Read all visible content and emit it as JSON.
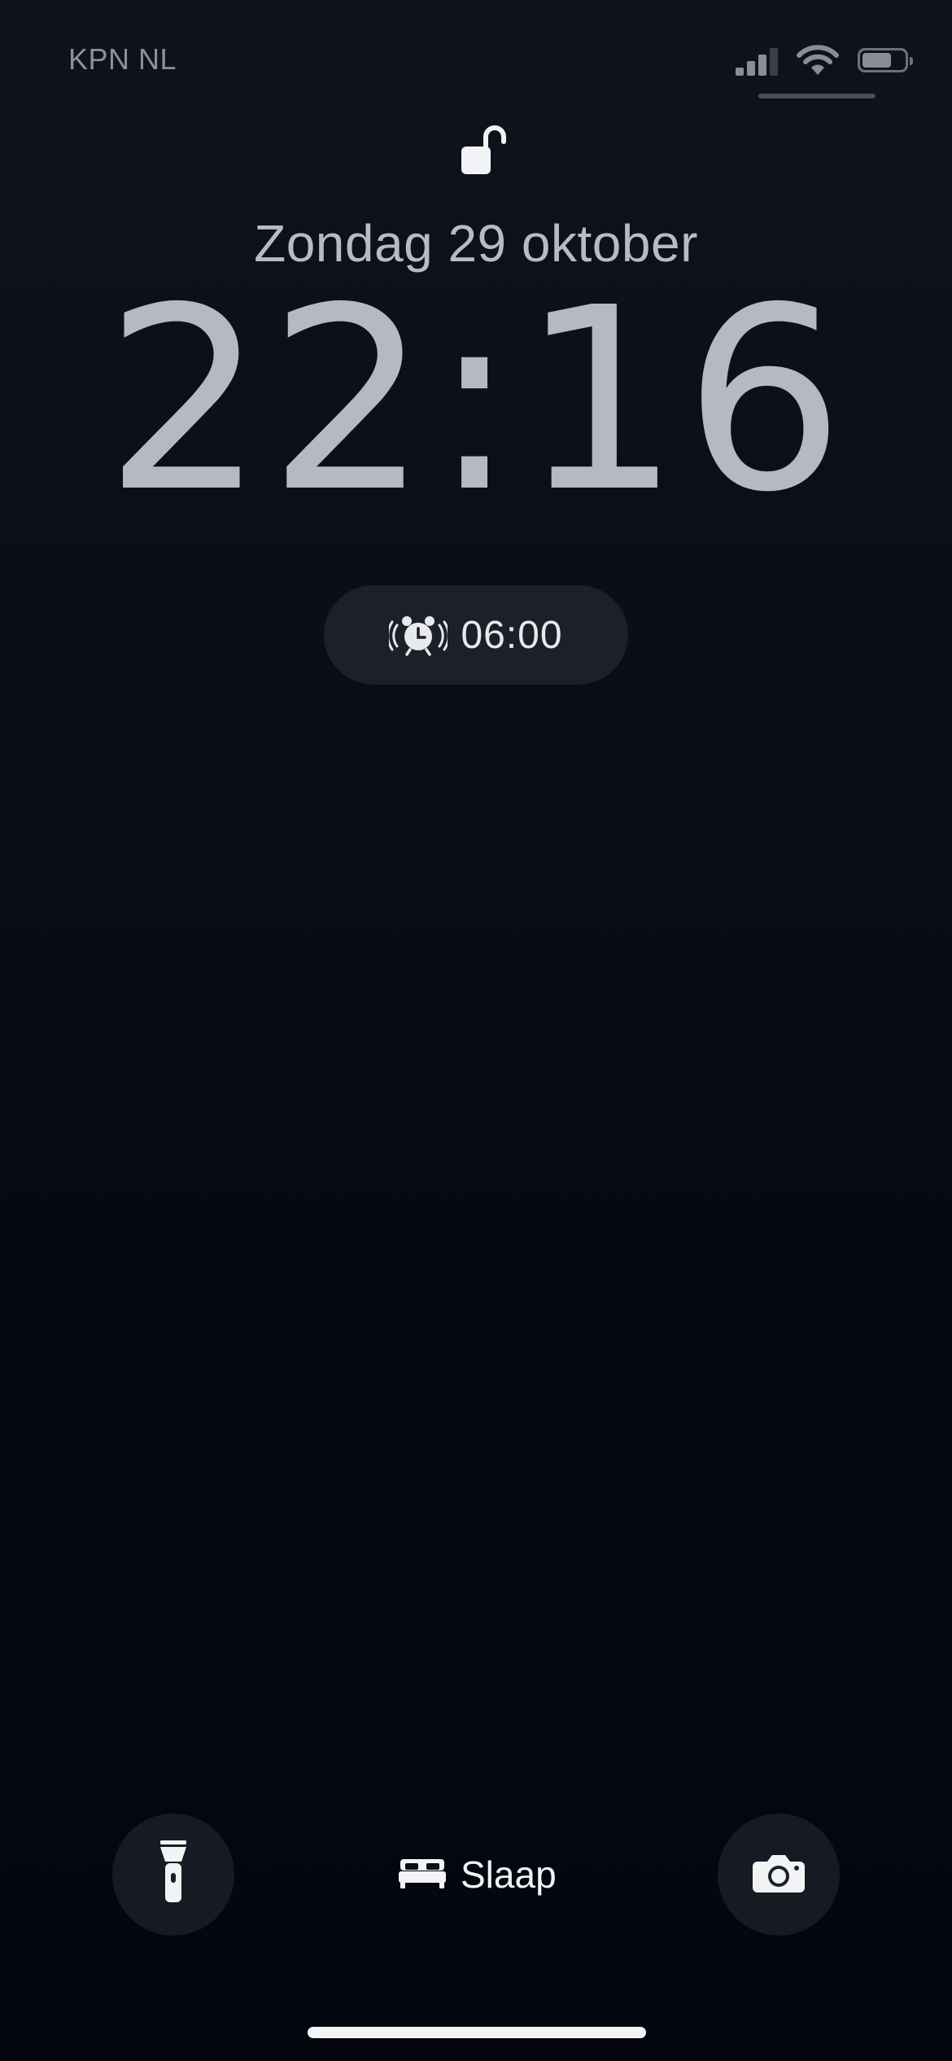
{
  "status_bar": {
    "carrier": "KPN NL",
    "signal_bars_active": 3,
    "signal_bars_total": 4,
    "wifi_icon": "wifi-icon",
    "battery_level": 0.7
  },
  "lock": {
    "state": "unlocked",
    "icon": "lock-open-icon"
  },
  "lockscreen": {
    "date": "Zondag 29 oktober",
    "time": "22:16"
  },
  "alarm": {
    "icon": "alarm-clock-icon",
    "time": "06:00"
  },
  "bottom_bar": {
    "flashlight_icon": "flashlight-icon",
    "sleep_icon": "bed-icon",
    "sleep_label": "Slaap",
    "camera_icon": "camera-icon"
  },
  "colors": {
    "background_top": "#0f131b",
    "background_bottom": "#03060f",
    "clock_text": "#b5b9c3",
    "button_bg": "rgba(255,255,255,0.08)"
  }
}
